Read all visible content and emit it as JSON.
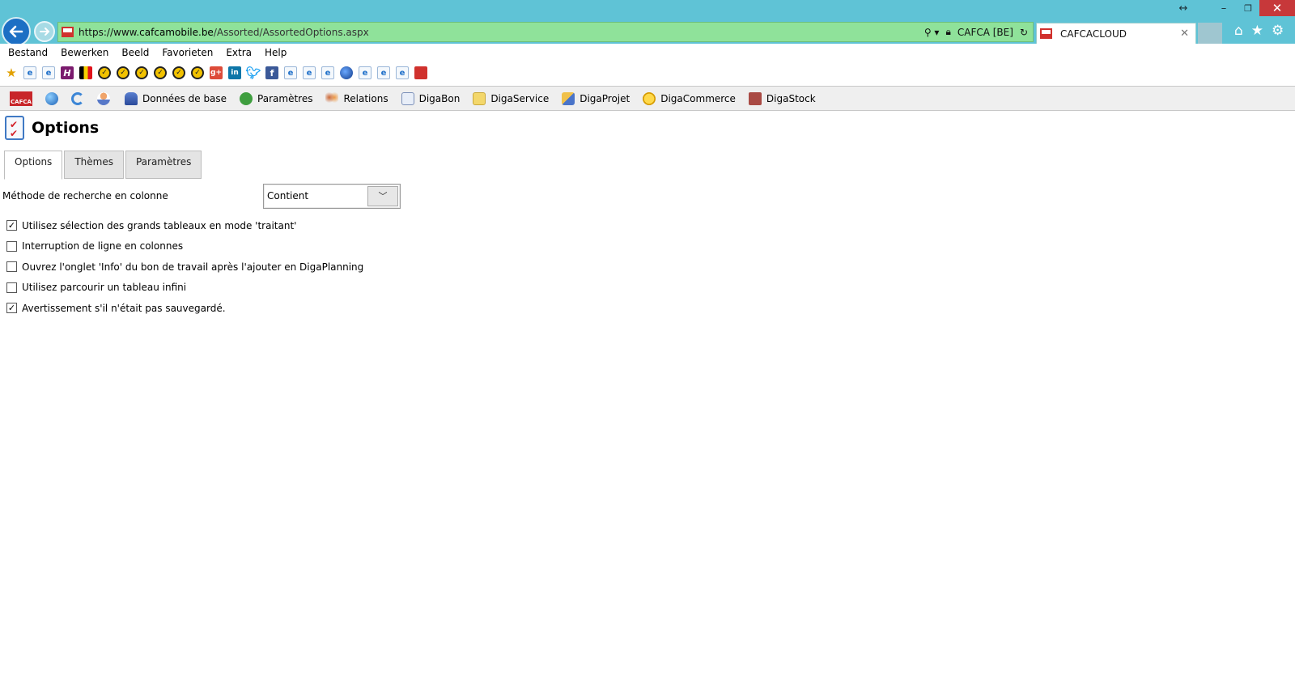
{
  "browser": {
    "url_prefix": "https://www.",
    "url_host": "cafcamobile.be",
    "url_path": "/Assorted/AssortedOptions.aspx",
    "site_identity": "CAFCA [BE]",
    "tab_title": "CAFCACLOUD"
  },
  "menu": [
    "Bestand",
    "Bewerken",
    "Beeld",
    "Favorieten",
    "Extra",
    "Help"
  ],
  "app_toolbar": {
    "items": [
      "Données de base",
      "Paramètres",
      "Relations",
      "DigaBon",
      "DigaService",
      "DigaProjet",
      "DigaCommerce",
      "DigaStock"
    ]
  },
  "page": {
    "title": "Options",
    "tabs": [
      "Options",
      "Thèmes",
      "Paramètres"
    ],
    "search_method": {
      "label": "Méthode de recherche en colonne",
      "value": "Contient"
    },
    "options": [
      {
        "label": "Utilisez sélection des grands tableaux en mode 'traitant'",
        "checked": true
      },
      {
        "label": "Interruption de ligne en colonnes",
        "checked": false
      },
      {
        "label": "Ouvrez l'onglet 'Info' du bon de travail après l'ajouter en DigaPlanning",
        "checked": false
      },
      {
        "label": "Utilisez parcourir un tableau infini",
        "checked": false
      },
      {
        "label": "Avertissement s'il n'était pas sauvegardé.",
        "checked": true
      }
    ]
  }
}
